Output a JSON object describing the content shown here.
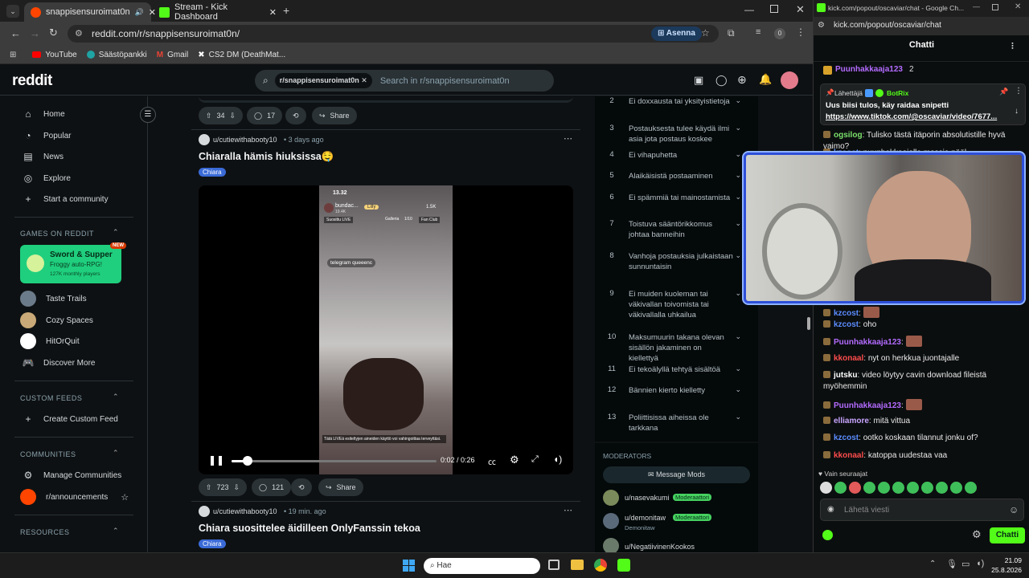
{
  "browser": {
    "tabs": [
      {
        "label": "snappisensuroimat0n"
      },
      {
        "label": "Stream - Kick Dashboard"
      }
    ],
    "url": "reddit.com/r/snappisensuroimat0n/",
    "install_label": "Asenna",
    "ext_badge": "0",
    "bookmarks": [
      "YouTube",
      "Säästöpankki",
      "Gmail",
      "CS2 DM (DeathMat..."
    ]
  },
  "reddit": {
    "logo": "reddit",
    "search_chip": "r/snappisensuroimat0n",
    "search_placeholder": "Search in r/snappisensuroimat0n",
    "nav": {
      "home": "Home",
      "popular": "Popular",
      "news": "News",
      "explore": "Explore",
      "start": "Start a community"
    },
    "games_hdr": "GAMES ON REDDIT",
    "game_feature": {
      "title": "Sword & Supper",
      "sub": "Froggy auto-RPG!",
      "count": "127K monthly players",
      "badge": "NEW"
    },
    "games": [
      "Taste Trails",
      "Cozy Spaces",
      "HitOrQuit",
      "Discover More"
    ],
    "custom_hdr": "CUSTOM FEEDS",
    "custom_create": "Create Custom Feed",
    "comm_hdr": "COMMUNITIES",
    "manage": "Manage Communities",
    "announce": "r/announcements",
    "res_hdr": "RESOURCES",
    "post0": {
      "votes": "34",
      "comments": "17",
      "share": "Share"
    },
    "post1": {
      "author": "u/cutiewithabooty10",
      "age": "3 days ago",
      "title": "Chiaralla hämis hiuksissa🤤",
      "flair": "Chiara",
      "votes": "723",
      "comments": "121",
      "share": "Share",
      "video": {
        "phone_time": "13.32",
        "phone_user": "bundac...",
        "phone_sub": "19.4K",
        "badge_lilly": "Lilly",
        "count": "1.5K",
        "tab1": "Suosittu LIVE",
        "tab2": "Galleria",
        "tab3": "1/10",
        "tab4": "Fan Club",
        "tag": "telegram queeenc",
        "warn": "Tätä LIVEä esiteltyjen aineiden käyttö voi vahingoittaa terveyttäsi.",
        "time": "0:02 / 0:26"
      }
    },
    "post2": {
      "author": "u/cutiewithabooty10",
      "age": "19 min. ago",
      "title": "Chiara suosittelee äidilleen OnlyFanssin tekoa",
      "flair": "Chiara"
    },
    "rules": [
      {
        "n": "2",
        "t": "Ei doxxausta tai yksityistietoja"
      },
      {
        "n": "3",
        "t": "Postauksesta tulee käydä ilmi asia jota postaus koskee"
      },
      {
        "n": "4",
        "t": "Ei vihapuhetta"
      },
      {
        "n": "5",
        "t": "Alaikäisistä postaaminen"
      },
      {
        "n": "6",
        "t": "Ei spämmiä tai mainostamista"
      },
      {
        "n": "7",
        "t": "Toistuva sääntörikkomus johtaa banneihin"
      },
      {
        "n": "8",
        "t": "Vanhoja postauksia julkaistaan sunnuntaisin"
      },
      {
        "n": "9",
        "t": "Ei muiden kuoleman tai väkivallan toivomista tai väkivallalla uhkailua"
      },
      {
        "n": "10",
        "t": "Maksumuurin takana olevan sisällön jakaminen on kiellettyä"
      },
      {
        "n": "11",
        "t": "Ei tekoälyllä tehtyä sisältöä"
      },
      {
        "n": "12",
        "t": "Bännien kierto kielletty"
      },
      {
        "n": "13",
        "t": "Poliittisissa aiheissa ole tarkkana"
      }
    ],
    "mods_hdr": "MODERATORS",
    "message_mods": "Message Mods",
    "mods": [
      {
        "name": "u/nasevakumi",
        "badge": "Moderaattori"
      },
      {
        "name": "u/demonitaw",
        "badge": "Moderaattori",
        "sub": "Demonitaw"
      },
      {
        "name": "u/NegatiivinenKookos"
      }
    ]
  },
  "kick": {
    "window_title": "kick.com/popout/oscaviar/chat - Google Ch...",
    "url": "kick.com/popout/oscaviar/chat",
    "chat_title": "Chatti",
    "top_user": "Puunhakkaaja123",
    "top_num": "2",
    "pinned": {
      "sender_label": "Lähettäjä",
      "sender": "BotRix",
      "text": "Uus biisi tulos, käy raidaa snipetti",
      "link": "https://www.tiktok.com/@oscaviar/video/7677..."
    },
    "messages": [
      {
        "user": "ogsilog",
        "text": "Tulisko tästä itäporin absolutistille hyvä vaimo?",
        "color": "#7be06b"
      },
      {
        "user": "kzcost",
        "text": "puunhakkaajalla massia pääl",
        "color": "#5b8cff"
      },
      {
        "user": "kzcost",
        "text": "",
        "color": "#5b8cff"
      },
      {
        "user": "kzcost",
        "text": "oho",
        "color": "#5b8cff"
      },
      {
        "user": "Puunhakkaaja123",
        "text": "",
        "color": "#b36bff"
      },
      {
        "user": "kkonaal",
        "text": "nyt on herkkua juontajalle",
        "color": "#ff4d4d"
      },
      {
        "user": "jutsku",
        "text": "video löytyy cavin download fileistä myöhemmin",
        "color": "#ffffff"
      },
      {
        "user": "Puunhakkaaja123",
        "text": "",
        "color": "#b36bff"
      },
      {
        "user": "elliamore",
        "text": "mitä vittua",
        "color": "#c8a6ff"
      },
      {
        "user": "kzcost",
        "text": "ootko koskaan tilannut jonku of?",
        "color": "#5b8cff"
      },
      {
        "user": "kkonaal",
        "text": "katoppa uudestaa vaa",
        "color": "#ff4d4d"
      }
    ],
    "followers_only": "Vain seuraajat",
    "input_placeholder": "Lähetä viesti",
    "send_label": "Chatti"
  },
  "taskbar": {
    "search": "Hae",
    "time": "21.09",
    "date": "25.8.2026"
  }
}
